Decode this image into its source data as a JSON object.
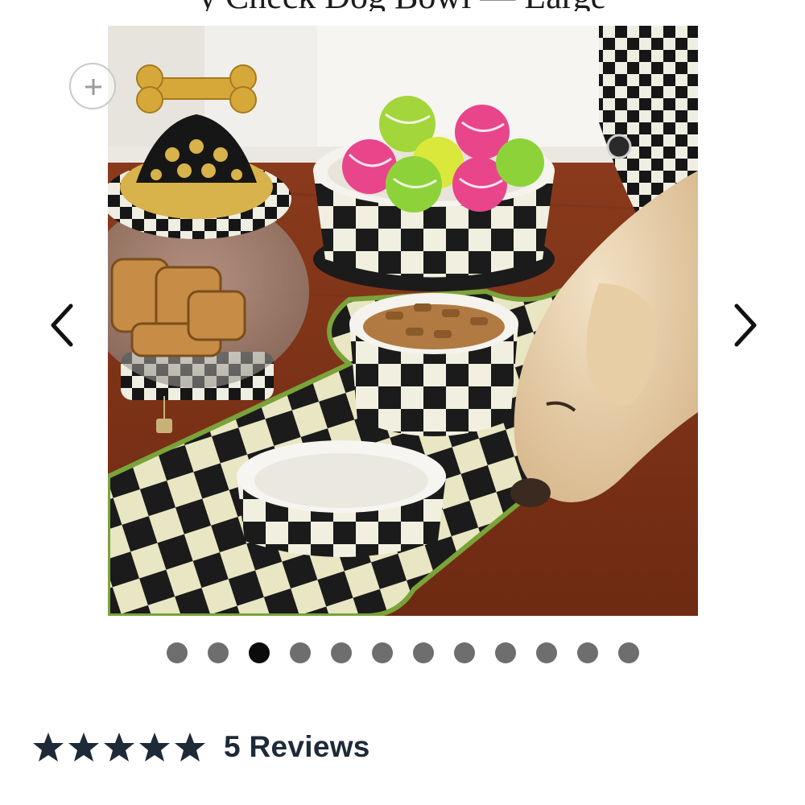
{
  "product": {
    "title_fragment": "y Check Dog Bowl — Large"
  },
  "gallery": {
    "image_alt": "Checkered dog bowls, treat canister and mat with dog eating",
    "zoom_icon": "plus-circle-icon",
    "prev_icon": "chevron-left-icon",
    "next_icon": "chevron-right-icon",
    "slide_count": 12,
    "active_index": 2
  },
  "reviews": {
    "rating": 5,
    "max_rating": 5,
    "star_icon": "star-icon",
    "label": "5 Reviews"
  },
  "colors": {
    "star": "#1e2a38",
    "dot_active": "#0b0b0b",
    "dot_inactive": "#6e6e6e"
  }
}
